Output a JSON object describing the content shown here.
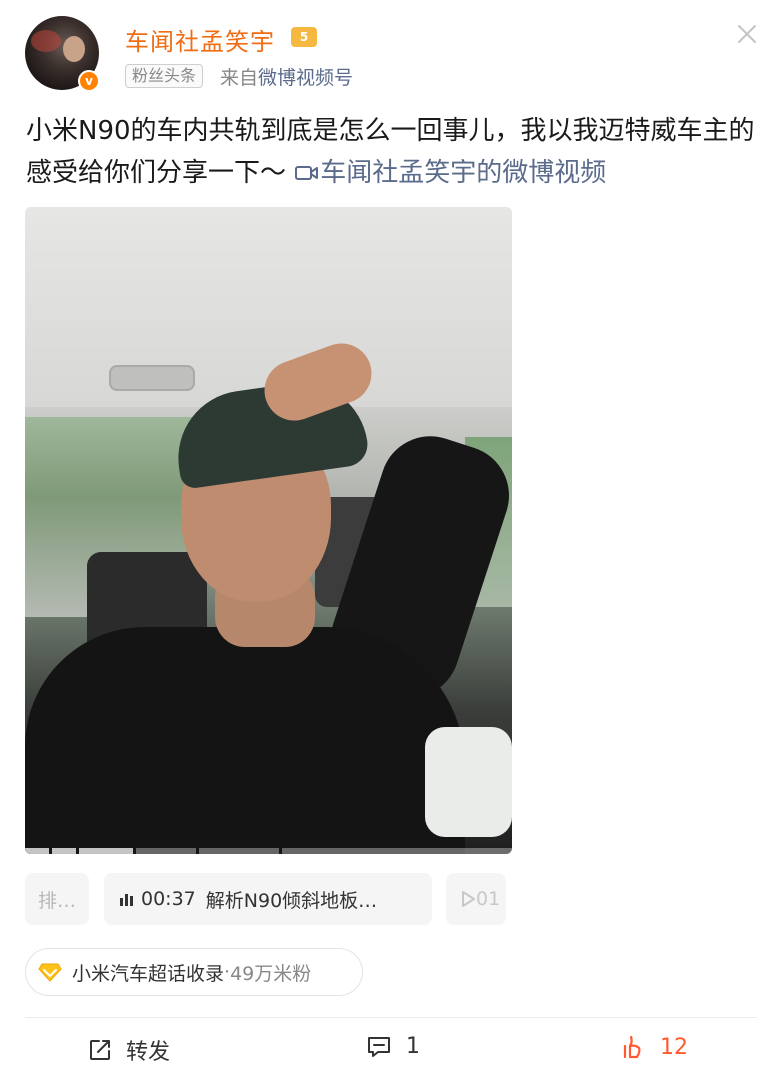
{
  "post": {
    "author_name": "车闻社孟笑宇",
    "author_level_badge": "5",
    "verified_mark": "v",
    "author_tag": "粉丝头条",
    "source_prefix": "来自",
    "source_link": "微博视频号",
    "text": "小米N90的车内共轨到底是怎么一回事儿，我以我迈特威车主的感受给你们分享一下～",
    "video_link_label": "车闻社孟笑宇的微博视频"
  },
  "video": {
    "progress_segments": 5
  },
  "chapters": {
    "prev_label": "排…",
    "current_time": "00:37",
    "current_title": "解析N90倾斜地板…",
    "next_time_partial": "01"
  },
  "topic": {
    "name": "小米汽车超话收录",
    "separator": "·",
    "fans": "49万米粉"
  },
  "actions": {
    "repost_label": "转发",
    "comment_count": "1",
    "like_count": "12"
  },
  "colors": {
    "author": "#f06d13",
    "link": "#5b6b8c",
    "verified": "#ff8200",
    "like": "#ff5b2e"
  },
  "icons": [
    "close-icon",
    "video-camera-icon",
    "audio-bars-icon",
    "play-icon",
    "diamond-icon",
    "repost-icon",
    "comment-icon",
    "like-icon"
  ]
}
